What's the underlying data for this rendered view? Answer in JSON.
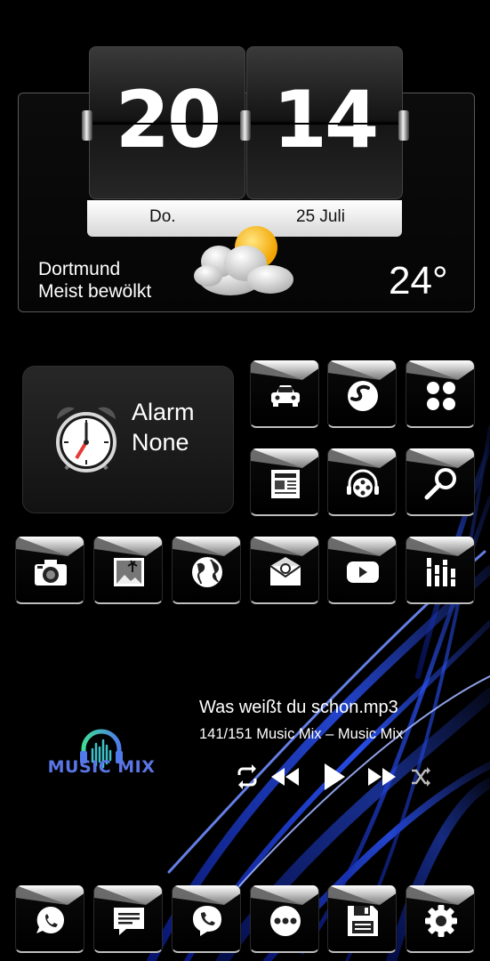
{
  "clock": {
    "hours": "20",
    "minutes": "14",
    "weekday": "Do.",
    "date": "25 Juli"
  },
  "weather": {
    "city": "Dortmund",
    "condition": "Meist bewölkt",
    "temperature": "24°",
    "icon": "partly-cloudy-icon"
  },
  "alarm": {
    "title": "Alarm",
    "value": "None",
    "icon": "alarm-clock-icon"
  },
  "app_rows": [
    [
      "car-app-icon",
      "swiftkey-app-icon",
      "apps-grid-icon"
    ],
    [
      "news-app-icon",
      "film-reel-headphones-icon",
      "search-tool-icon"
    ],
    [
      "camera-icon",
      "gallery-icon",
      "globe-icon",
      "email-icon",
      "youtube-icon",
      "equalizer-icon"
    ]
  ],
  "dock": [
    "whatsapp-icon",
    "messages-icon",
    "viber-icon",
    "app-drawer-icon",
    "save-disk-icon",
    "settings-gear-icon"
  ],
  "music": {
    "logo_text": "MUSIC MIX",
    "track": "Was weißt du schon.mp3",
    "playlist_info": "141/151 Music Mix – Music Mix",
    "controls": [
      "repeat-icon",
      "rewind-icon",
      "play-icon",
      "fast-forward-icon",
      "shuffle-icon"
    ]
  },
  "colors": {
    "background": "#000000",
    "accent_blue": "#2b55ff",
    "logo_blue": "#5a76e6",
    "logo_green": "#3ddc97",
    "alarm_hand": "#e53935"
  }
}
